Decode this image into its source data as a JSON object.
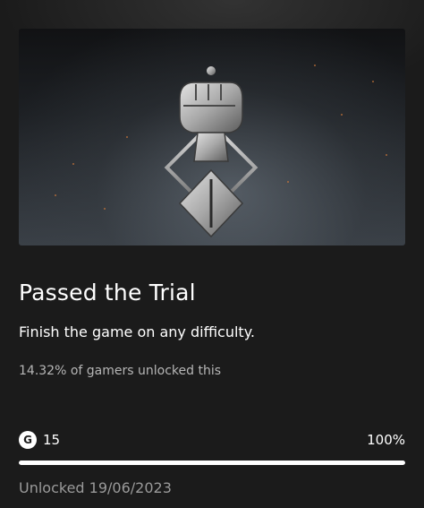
{
  "achievement": {
    "title": "Passed the Trial",
    "description": "Finish the game on any difficulty.",
    "rarity_text": "14.32% of gamers unlocked this",
    "gamerscore_icon": "G",
    "gamerscore": "15",
    "progress_label": "100%",
    "progress_value": 1.0,
    "unlocked_text": "Unlocked 19/06/2023",
    "emblem_icon": "raised-fist-emblem-icon"
  },
  "colors": {
    "background": "#1b1b1b",
    "text": "#ffffff",
    "secondary_text": "#b6b6b6",
    "progress_fill": "#ffffff"
  }
}
